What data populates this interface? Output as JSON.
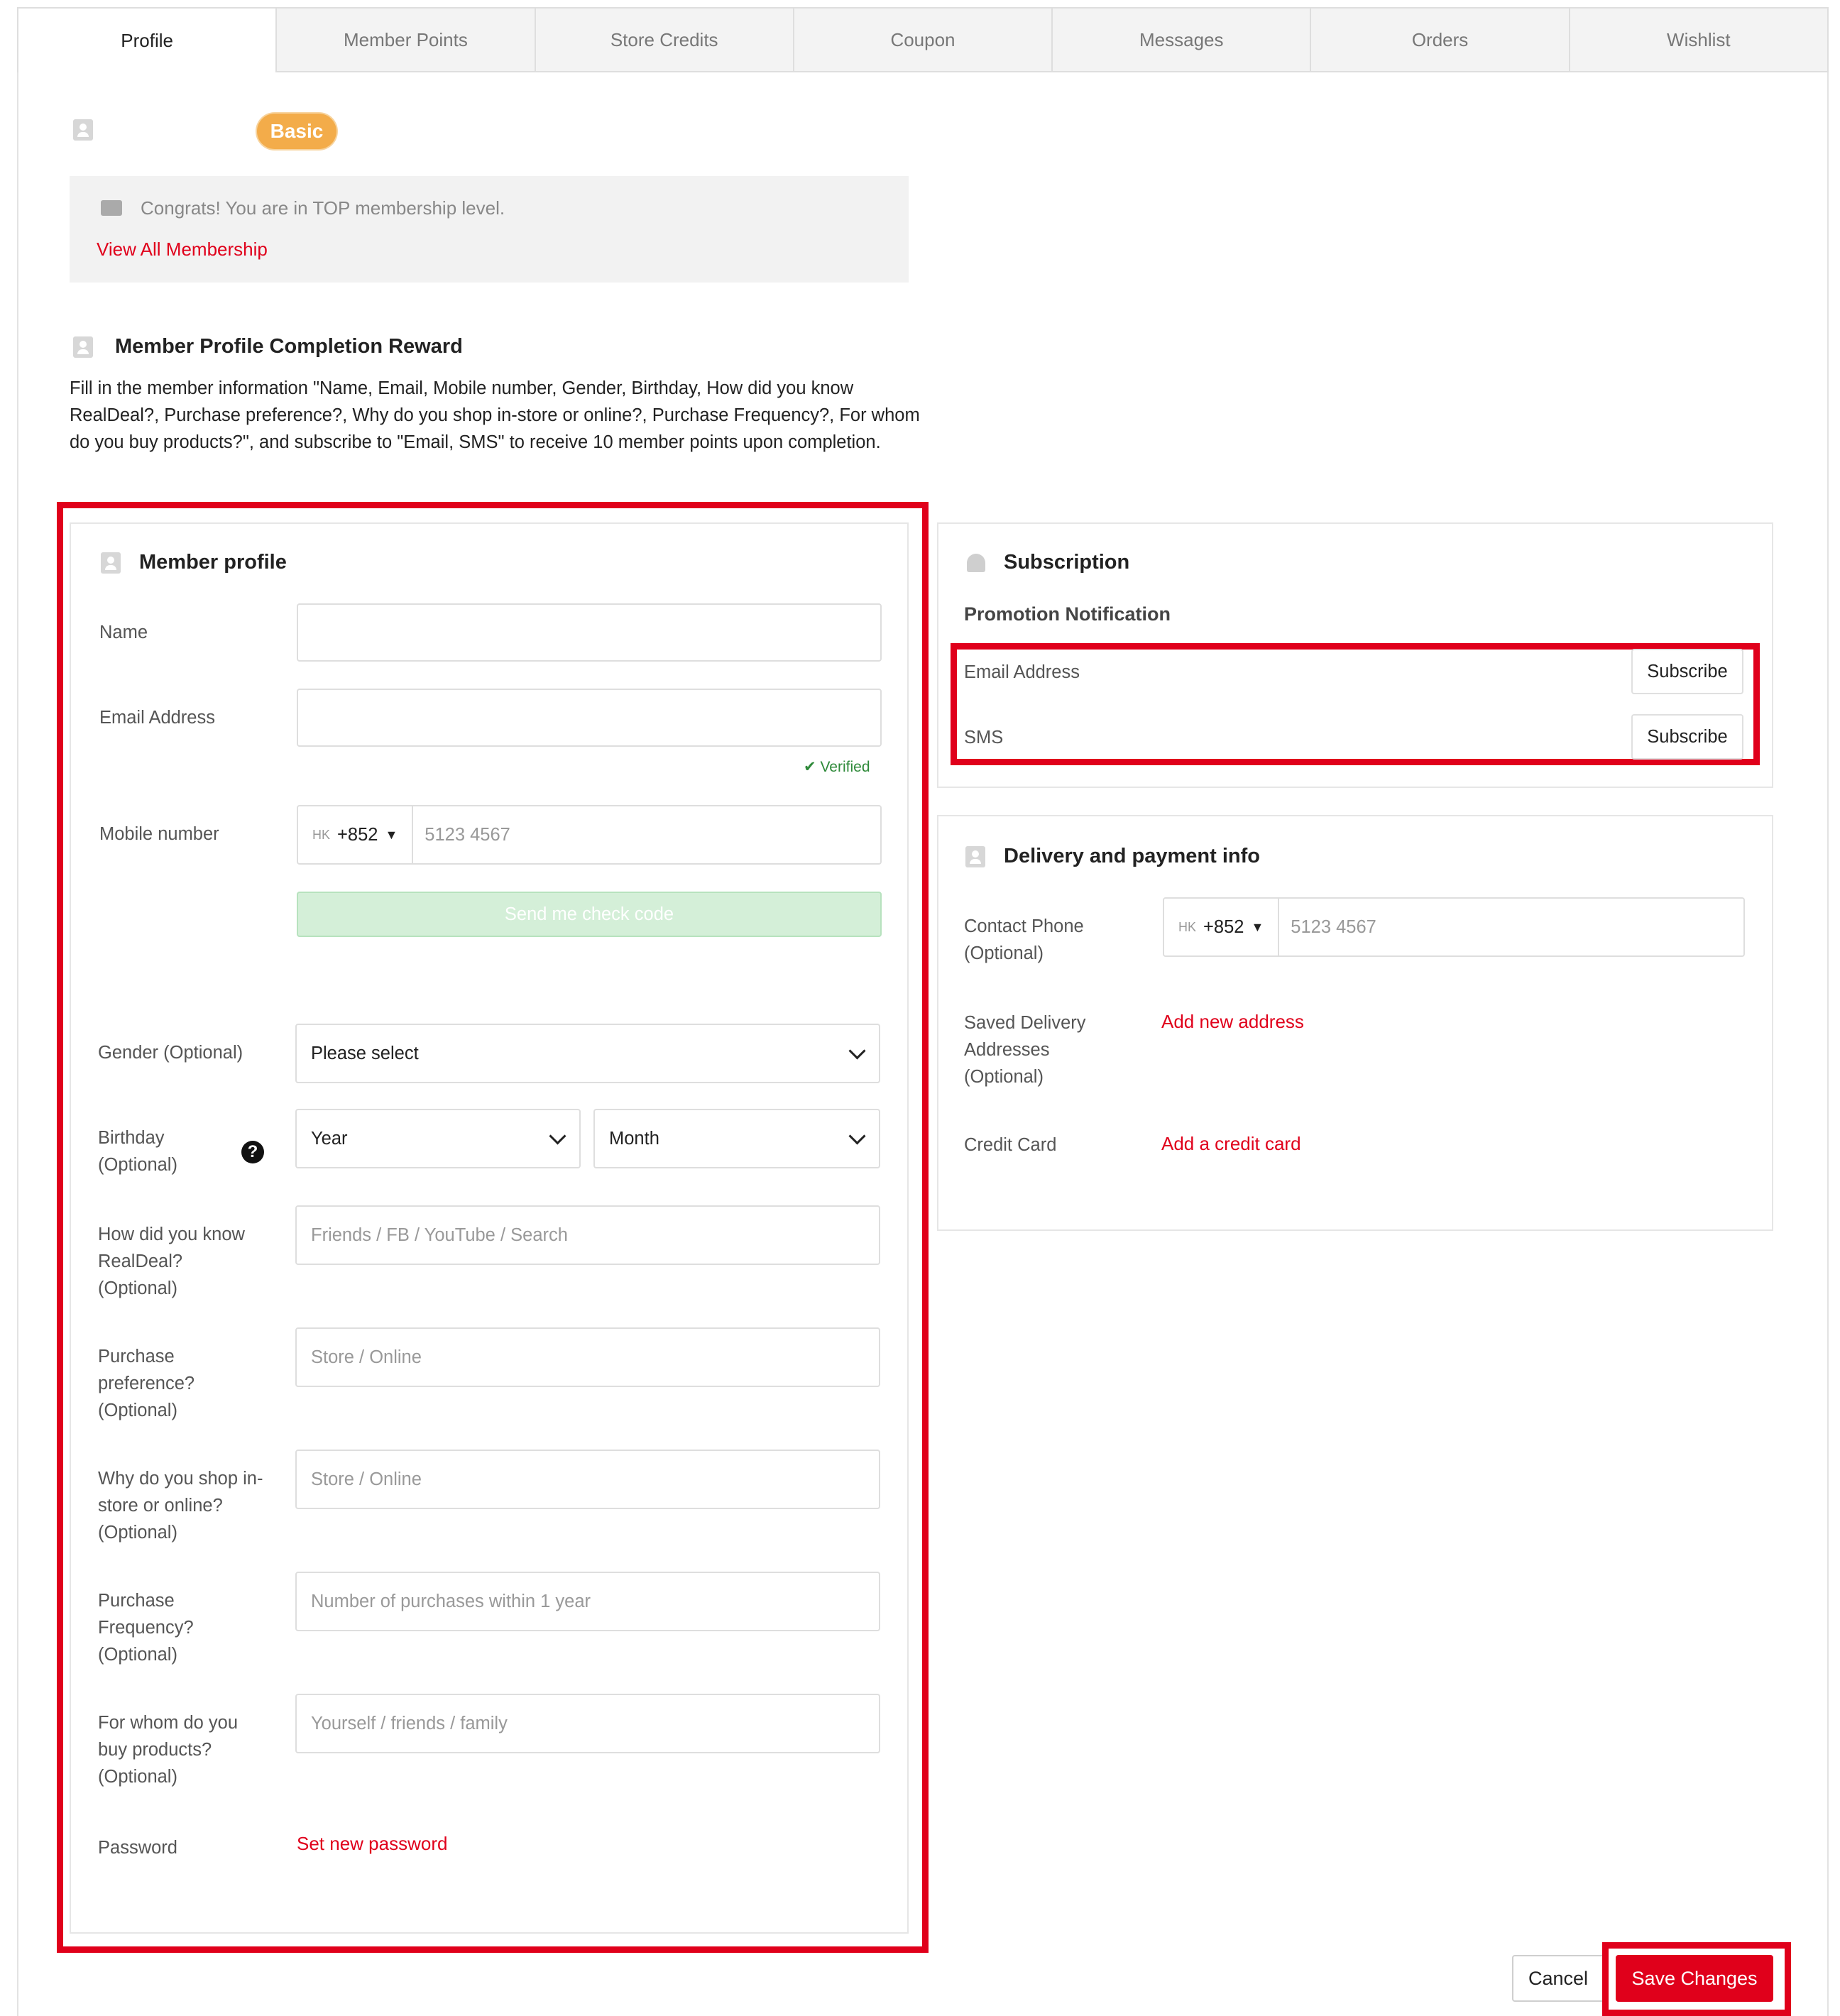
{
  "tabs": [
    "Profile",
    "Member Points",
    "Store Credits",
    "Coupon",
    "Messages",
    "Orders",
    "Wishlist"
  ],
  "membership": {
    "level_badge": "Basic",
    "congrats": "Congrats! You are in TOP membership level.",
    "view_all": "View All Membership"
  },
  "reward": {
    "title": "Member Profile Completion Reward",
    "description": "Fill in the member information \"Name, Email, Mobile number, Gender, Birthday, How did you know RealDeal?, Purchase preference?, Why do you shop in-store or online?, Purchase Frequency?, For whom do you buy products?\", and subscribe to \"Email, SMS\" to receive 10 member points upon completion."
  },
  "member_profile": {
    "title": "Member profile",
    "name_label": "Name",
    "name_value": "",
    "email_label": "Email Address",
    "email_value": "",
    "verified": "Verified",
    "mobile_label": "Mobile number",
    "mobile_cc": "HK",
    "mobile_prefix": "+852",
    "mobile_placeholder": "5123 4567",
    "send_code": "Send me check code",
    "gender_label": "Gender (Optional)",
    "gender_value": "Please select",
    "birthday_label_1": "Birthday",
    "birthday_label_2": "(Optional)",
    "year_value": "Year",
    "month_value": "Month",
    "know_label": [
      "How did you know",
      "RealDeal?",
      "(Optional)"
    ],
    "know_placeholder": "Friends / FB / YouTube / Search",
    "pref_label": [
      "Purchase",
      "preference?",
      "(Optional)"
    ],
    "pref_placeholder": "Store / Online",
    "why_label": [
      "Why do you shop in-",
      "store or online?",
      "(Optional)"
    ],
    "why_placeholder": "Store / Online",
    "freq_label": [
      "Purchase",
      "Frequency?",
      "(Optional)"
    ],
    "freq_placeholder": "Number of purchases within 1 year",
    "whom_label": [
      "For whom do you",
      "buy products?",
      "(Optional)"
    ],
    "whom_placeholder": "Yourself / friends / family",
    "password_label": "Password",
    "password_link": "Set new password"
  },
  "subscription": {
    "title": "Subscription",
    "subtitle": "Promotion Notification",
    "email_label": "Email Address",
    "sms_label": "SMS",
    "subscribe": "Subscribe"
  },
  "delivery": {
    "title": "Delivery and payment info",
    "contact_label_1": "Contact Phone",
    "contact_label_2": "(Optional)",
    "contact_cc": "HK",
    "contact_prefix": "+852",
    "contact_placeholder": "5123 4567",
    "saved_label": [
      "Saved Delivery",
      "Addresses",
      "(Optional)"
    ],
    "add_address": "Add new address",
    "card_label": "Credit Card",
    "add_card": "Add a credit card"
  },
  "actions": {
    "cancel": "Cancel",
    "save": "Save Changes"
  },
  "colors": {
    "accent_red": "#e0001b",
    "badge_orange": "#f3ac4a",
    "send_code_green": "#d4efd8"
  }
}
